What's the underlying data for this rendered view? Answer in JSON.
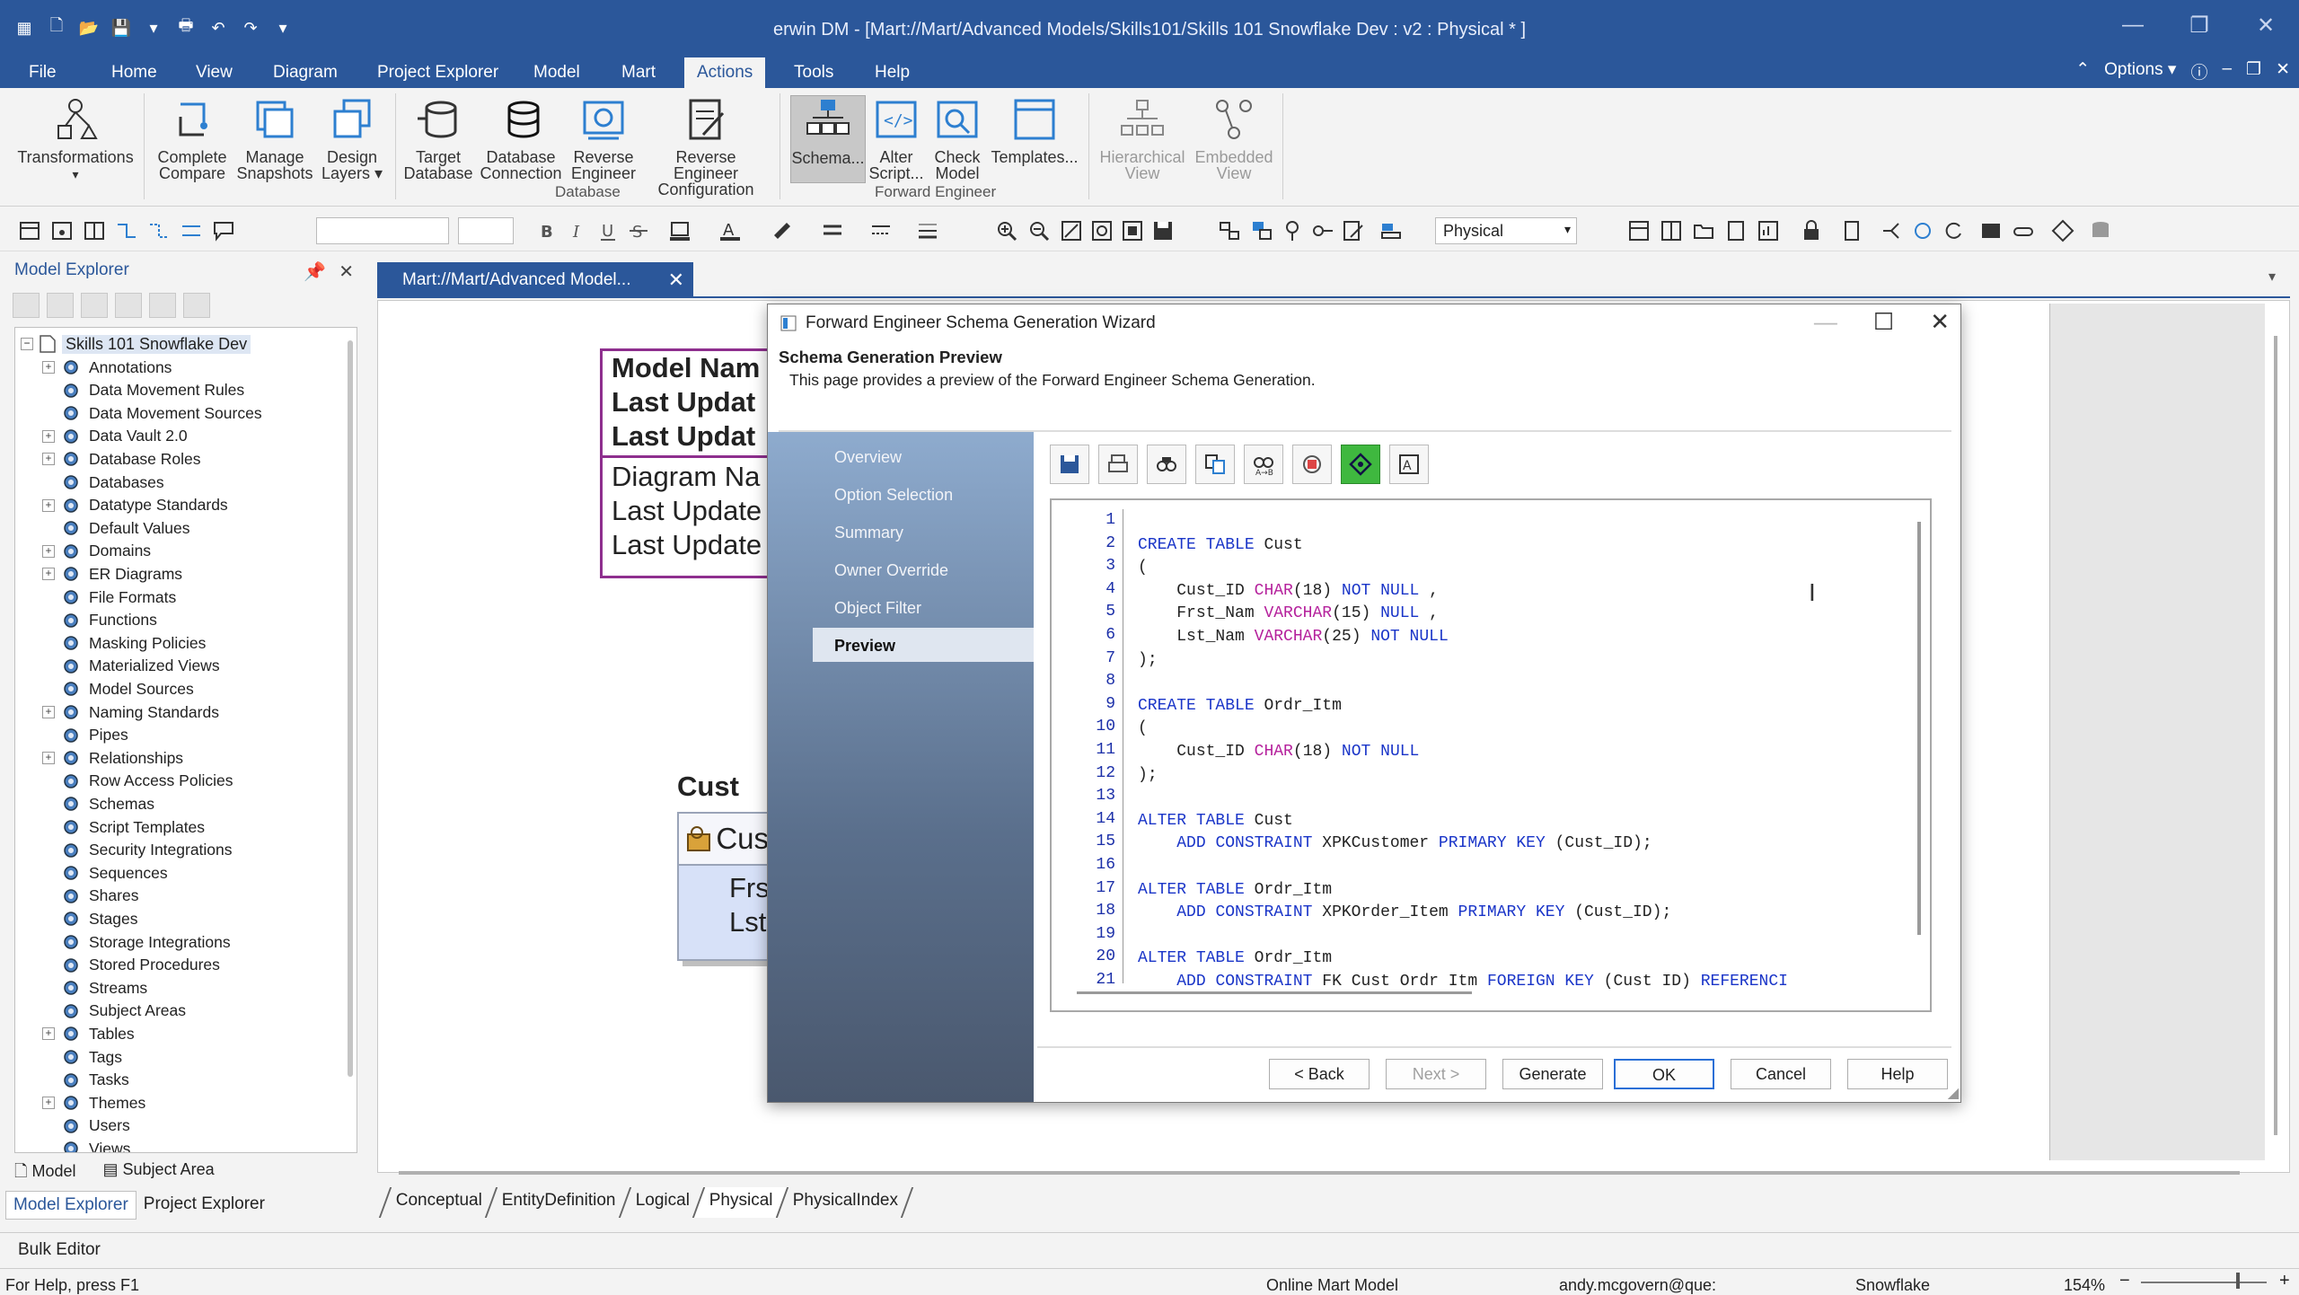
{
  "window": {
    "title": "erwin DM - [Mart://Mart/Advanced Models/Skills101/Skills 101 Snowflake Dev : v2 : Physical * ]"
  },
  "menu": {
    "tabs": [
      "File",
      "Home",
      "View",
      "Diagram",
      "Project Explorer",
      "Model",
      "Mart",
      "Actions",
      "Tools",
      "Help"
    ],
    "active": "Actions",
    "options_label": "Options"
  },
  "ribbon": {
    "buttons": {
      "transformations": "Transformations",
      "complete_compare": "Complete Compare",
      "manage_snapshots": "Manage Snapshots",
      "design_layers": "Design Layers",
      "target_database": "Target Database",
      "database_connection": "Database Connection",
      "reverse_engineer": "Reverse Engineer",
      "reverse_engineer_config": "Reverse Engineer Configuration",
      "schema": "Schema...",
      "alter_script": "Alter Script...",
      "check_model": "Check Model",
      "templates": "Templates...",
      "hierarchical_view": "Hierarchical View",
      "embedded_view": "Embedded View"
    },
    "groups": {
      "database": "Database",
      "forward_engineer": "Forward Engineer"
    }
  },
  "toolbar": {
    "view_combo": "Physical"
  },
  "explorer": {
    "title": "Model Explorer",
    "root": "Skills 101 Snowflake Dev",
    "items": [
      {
        "label": "Annotations",
        "expandable": true
      },
      {
        "label": "Data Movement Rules",
        "expandable": false
      },
      {
        "label": "Data Movement Sources",
        "expandable": false
      },
      {
        "label": "Data Vault 2.0",
        "expandable": true
      },
      {
        "label": "Database Roles",
        "expandable": true
      },
      {
        "label": "Databases",
        "expandable": false
      },
      {
        "label": "Datatype Standards",
        "expandable": true
      },
      {
        "label": "Default Values",
        "expandable": false
      },
      {
        "label": "Domains",
        "expandable": true
      },
      {
        "label": "ER Diagrams",
        "expandable": true
      },
      {
        "label": "File Formats",
        "expandable": false
      },
      {
        "label": "Functions",
        "expandable": false
      },
      {
        "label": "Masking Policies",
        "expandable": false
      },
      {
        "label": "Materialized Views",
        "expandable": false
      },
      {
        "label": "Model Sources",
        "expandable": false
      },
      {
        "label": "Naming Standards",
        "expandable": true
      },
      {
        "label": "Pipes",
        "expandable": false
      },
      {
        "label": "Relationships",
        "expandable": true
      },
      {
        "label": "Row Access Policies",
        "expandable": false
      },
      {
        "label": "Schemas",
        "expandable": false
      },
      {
        "label": "Script Templates",
        "expandable": false
      },
      {
        "label": "Security Integrations",
        "expandable": false
      },
      {
        "label": "Sequences",
        "expandable": false
      },
      {
        "label": "Shares",
        "expandable": false
      },
      {
        "label": "Stages",
        "expandable": false
      },
      {
        "label": "Storage Integrations",
        "expandable": false
      },
      {
        "label": "Stored Procedures",
        "expandable": false
      },
      {
        "label": "Streams",
        "expandable": false
      },
      {
        "label": "Subject Areas",
        "expandable": false
      },
      {
        "label": "Tables",
        "expandable": true
      },
      {
        "label": "Tags",
        "expandable": false
      },
      {
        "label": "Tasks",
        "expandable": false
      },
      {
        "label": "Themes",
        "expandable": true
      },
      {
        "label": "Users",
        "expandable": false
      },
      {
        "label": "Views",
        "expandable": false
      }
    ],
    "bottom_tabs": [
      "Model",
      "Subject Area"
    ],
    "panel_tabs": [
      "Model Explorer",
      "Project Explorer"
    ]
  },
  "document": {
    "tab_title": "Mart://Mart/Advanced Model...",
    "entity_box": {
      "rows_bold": [
        "Model Nam",
        "Last Updat",
        "Last Updat"
      ],
      "rows": [
        "Diagram Na",
        "Last Update",
        "Last Update"
      ]
    },
    "cust": {
      "title": "Cust",
      "pk": "Cus",
      "attrs": [
        "Frs",
        "Lst"
      ]
    },
    "sheet_tabs": [
      "Conceptual",
      "EntityDefinition",
      "Logical",
      "Physical",
      "PhysicalIndex"
    ],
    "active_sheet": "Physical"
  },
  "dialog": {
    "title": "Forward Engineer Schema Generation Wizard",
    "heading": "Schema Generation Preview",
    "description": "This page provides a preview of the Forward Engineer Schema Generation.",
    "nav": [
      "Overview",
      "Option Selection",
      "Summary",
      "Owner Override",
      "Object Filter",
      "Preview"
    ],
    "active_nav": "Preview",
    "code_lines": [
      "",
      "CREATE TABLE Cust",
      "(",
      "    Cust_ID CHAR(18) NOT NULL ,",
      "    Frst_Nam VARCHAR(15) NULL ,",
      "    Lst_Nam VARCHAR(25) NOT NULL",
      ");",
      "",
      "CREATE TABLE Ordr_Itm",
      "(",
      "    Cust_ID CHAR(18) NOT NULL",
      ");",
      "",
      "ALTER TABLE Cust",
      "    ADD CONSTRAINT XPKCustomer PRIMARY KEY (Cust_ID);",
      "",
      "ALTER TABLE Ordr_Itm",
      "    ADD CONSTRAINT XPKOrder_Item PRIMARY KEY (Cust_ID);",
      "",
      "ALTER TABLE Ordr_Itm",
      "    ADD CONSTRAINT FK Cust Ordr Itm FOREIGN KEY (Cust ID) REFERENCI"
    ],
    "buttons": {
      "back": "< Back",
      "next": "Next >",
      "generate": "Generate",
      "ok": "OK",
      "cancel": "Cancel",
      "help": "Help"
    }
  },
  "bulk_editor": "Bulk Editor",
  "status": {
    "help": "For Help, press F1",
    "mart": "Online Mart Model",
    "user": "andy.mcgovern@que:",
    "db": "Snowflake",
    "zoom": "154%"
  },
  "colors": {
    "accent": "#2b579a",
    "entity_border": "#8e2f8e",
    "keyword": "#1a35c8",
    "datatype": "#b5219c"
  }
}
